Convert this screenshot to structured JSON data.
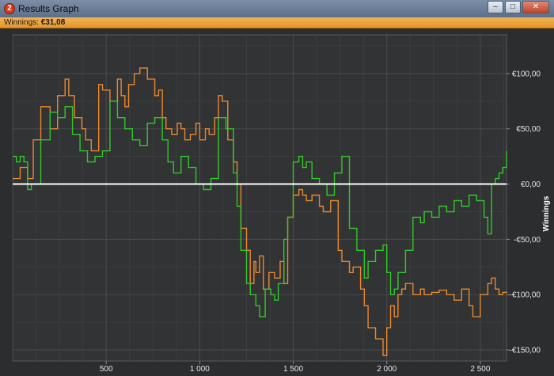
{
  "window": {
    "title": "Results Graph",
    "icon": "app-logo-icon",
    "buttons": [
      "minimize-icon",
      "maximize-icon",
      "close-icon"
    ]
  },
  "status": {
    "label": "Winnings:",
    "value": "€31,08"
  },
  "chart_data": {
    "type": "line",
    "ylabel": "Winnings",
    "xlabel": "",
    "xlim": [
      0,
      2640
    ],
    "ylim": [
      -160,
      135
    ],
    "grid": true,
    "y_axis_side": "right",
    "x_ticks": [
      500,
      1000,
      1500,
      2000,
      2500
    ],
    "x_tick_labels": [
      "500",
      "1 000",
      "1 500",
      "2 000",
      "2 500"
    ],
    "y_ticks": [
      100,
      50,
      0,
      -50,
      -100,
      -150
    ],
    "y_tick_labels": [
      "€100,00",
      "€50,00",
      "€0,00",
      "-€50,00",
      "-€100,00",
      "-€150,00"
    ],
    "reference_line": 0,
    "colors": {
      "orange": "#e8882e",
      "green": "#32c72b",
      "zero_line": "#ffffff"
    },
    "series": [
      {
        "color": "#e8882e",
        "x": [
          0,
          40,
          80,
          110,
          150,
          200,
          240,
          280,
          300,
          330,
          370,
          390,
          420,
          460,
          480,
          520,
          560,
          580,
          600,
          620,
          650,
          680,
          720,
          760,
          780,
          800,
          820,
          850,
          880,
          900,
          920,
          950,
          980,
          1000,
          1030,
          1050,
          1080,
          1100,
          1120,
          1150,
          1180,
          1200,
          1220,
          1250,
          1270,
          1290,
          1300,
          1320,
          1340,
          1370,
          1400,
          1430,
          1450,
          1470,
          1500,
          1530,
          1550,
          1570,
          1600,
          1640,
          1660,
          1700,
          1740,
          1760,
          1800,
          1820,
          1860,
          1880,
          1900,
          1940,
          1980,
          2000,
          2020,
          2040,
          2060,
          2080,
          2100,
          2140,
          2180,
          2200,
          2240,
          2280,
          2320,
          2360,
          2400,
          2440,
          2460,
          2500,
          2540,
          2560,
          2580,
          2600,
          2620,
          2640
        ],
        "y": [
          5,
          15,
          5,
          40,
          70,
          50,
          80,
          95,
          80,
          60,
          50,
          40,
          30,
          90,
          85,
          75,
          95,
          80,
          70,
          90,
          100,
          105,
          95,
          80,
          85,
          60,
          50,
          45,
          55,
          50,
          40,
          45,
          55,
          40,
          50,
          45,
          60,
          80,
          75,
          40,
          20,
          0,
          -40,
          -60,
          -90,
          -70,
          -80,
          -65,
          -95,
          -80,
          -85,
          -70,
          -90,
          -30,
          -10,
          -5,
          -10,
          -15,
          -10,
          -20,
          -25,
          -15,
          -60,
          -70,
          -80,
          -75,
          -95,
          -110,
          -130,
          -140,
          -155,
          -130,
          -110,
          -120,
          -100,
          -95,
          -90,
          -100,
          -95,
          -100,
          -98,
          -96,
          -100,
          -105,
          -95,
          -110,
          -120,
          -100,
          -90,
          -85,
          -95,
          -100,
          -98,
          -97
        ]
      },
      {
        "color": "#32c72b",
        "x": [
          0,
          20,
          40,
          60,
          80,
          100,
          150,
          200,
          240,
          280,
          320,
          360,
          400,
          440,
          480,
          520,
          560,
          600,
          640,
          680,
          720,
          760,
          800,
          830,
          860,
          900,
          940,
          980,
          1020,
          1060,
          1100,
          1140,
          1180,
          1200,
          1220,
          1250,
          1270,
          1300,
          1320,
          1350,
          1380,
          1400,
          1420,
          1450,
          1470,
          1500,
          1530,
          1550,
          1570,
          1600,
          1640,
          1680,
          1720,
          1760,
          1800,
          1840,
          1880,
          1900,
          1940,
          1980,
          2000,
          2020,
          2040,
          2060,
          2100,
          2140,
          2180,
          2200,
          2240,
          2280,
          2320,
          2360,
          2400,
          2440,
          2480,
          2520,
          2540,
          2560,
          2580,
          2600,
          2620,
          2640
        ],
        "y": [
          25,
          20,
          25,
          20,
          -5,
          0,
          40,
          65,
          60,
          70,
          45,
          30,
          20,
          25,
          30,
          75,
          60,
          50,
          40,
          35,
          55,
          60,
          40,
          20,
          10,
          25,
          15,
          0,
          -5,
          5,
          60,
          50,
          10,
          -20,
          -60,
          -90,
          -100,
          -110,
          -120,
          -95,
          -100,
          -105,
          -90,
          -50,
          -30,
          20,
          25,
          15,
          20,
          5,
          0,
          -10,
          10,
          25,
          -40,
          -60,
          -85,
          -70,
          -60,
          -55,
          -80,
          -100,
          -95,
          -80,
          -60,
          -30,
          -35,
          -25,
          -30,
          -20,
          -25,
          -15,
          -20,
          -10,
          -15,
          -30,
          -45,
          0,
          5,
          10,
          15,
          30
        ]
      }
    ]
  }
}
